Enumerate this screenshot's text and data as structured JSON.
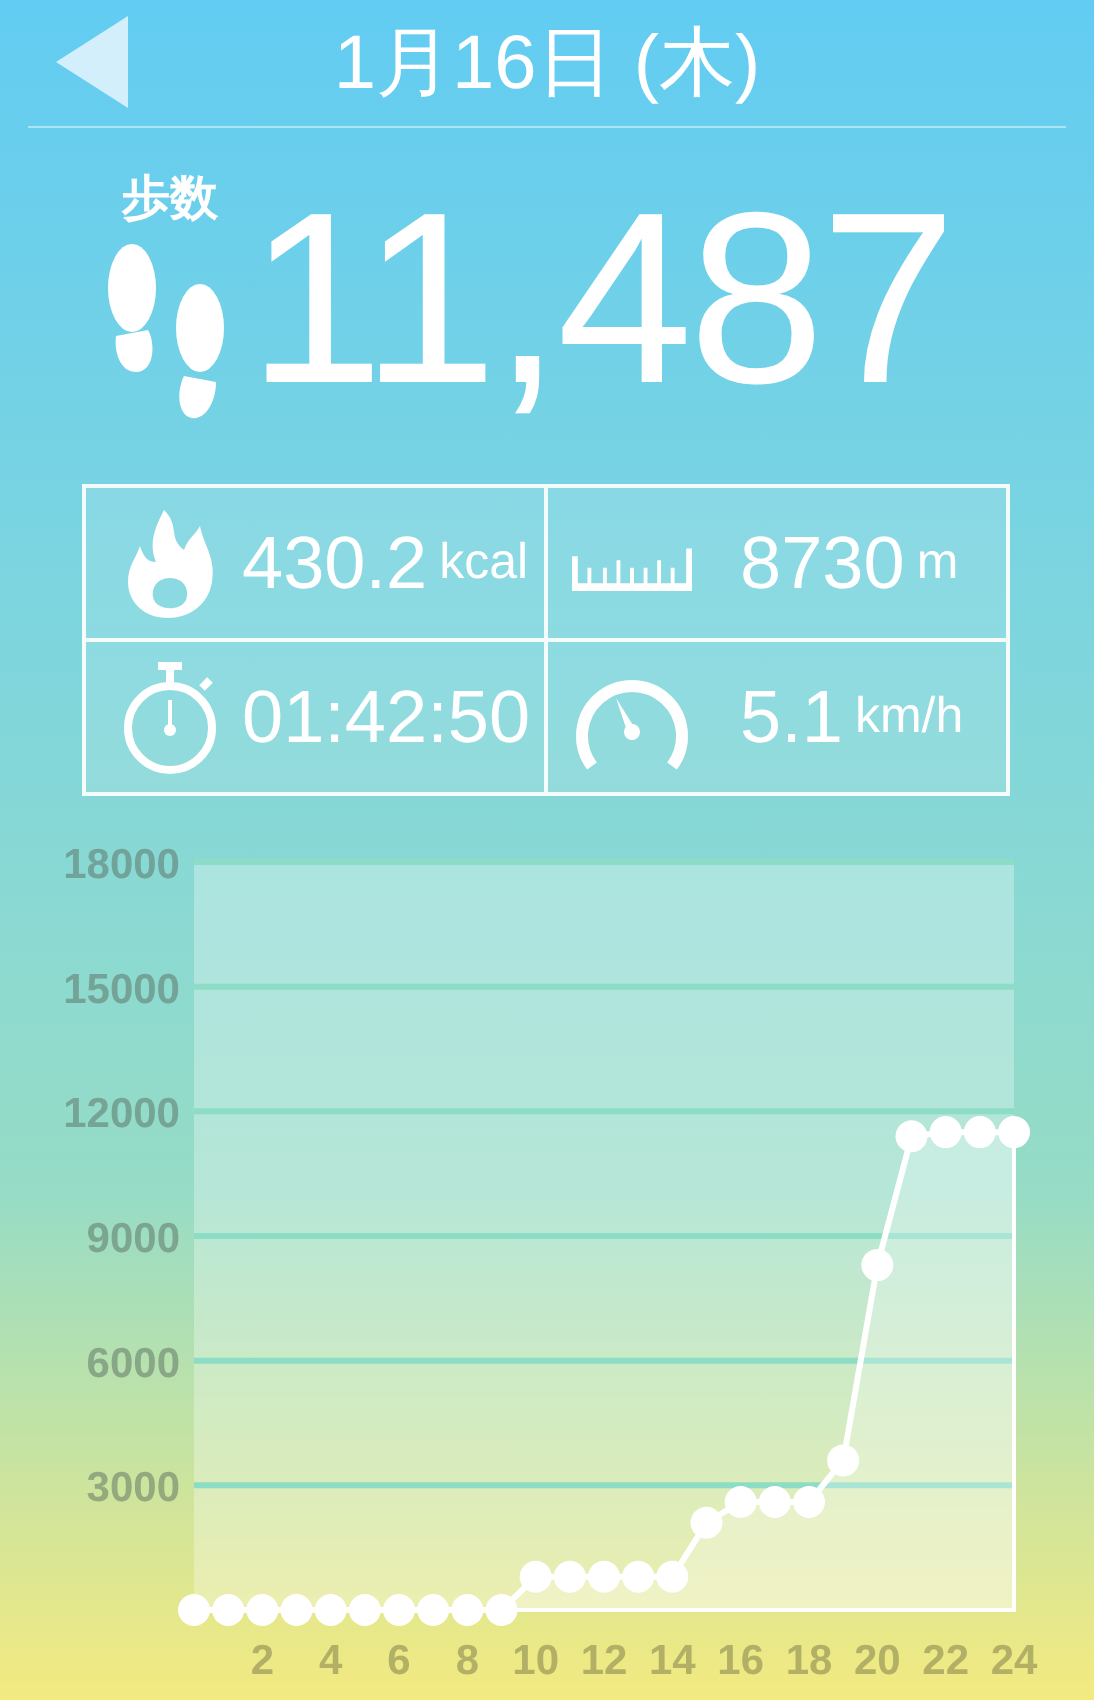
{
  "header": {
    "title": "1月16日 (木)"
  },
  "steps": {
    "label": "歩数",
    "value": "11,487"
  },
  "stats": [
    {
      "kind": "calories",
      "value": "430.2",
      "unit": "kcal"
    },
    {
      "kind": "distance",
      "value": "8730",
      "unit": "m"
    },
    {
      "kind": "time",
      "value": "01:42:50"
    },
    {
      "kind": "speed",
      "value": "5.1",
      "unit": "km/h"
    }
  ],
  "chart": {
    "chart_data": {
      "type": "area",
      "x": [
        0,
        1,
        2,
        3,
        4,
        5,
        6,
        7,
        8,
        9,
        10,
        11,
        12,
        13,
        14,
        15,
        16,
        17,
        18,
        19,
        20,
        21,
        22,
        23,
        24
      ],
      "series": [
        {
          "color": "#ffffff",
          "values": [
            0,
            0,
            0,
            0,
            0,
            0,
            0,
            0,
            0,
            0,
            800,
            800,
            800,
            800,
            800,
            2100,
            2600,
            2600,
            2600,
            3600,
            8300,
            11400,
            11500,
            11500,
            11500
          ]
        }
      ],
      "grid": true,
      "xlim": [
        0,
        24
      ],
      "ylim": [
        0,
        18000
      ],
      "xticks": [
        2,
        4,
        6,
        8,
        10,
        12,
        14,
        16,
        18,
        20,
        22,
        24
      ],
      "yticks": [
        3000,
        6000,
        9000,
        12000,
        15000,
        18000
      ]
    }
  }
}
